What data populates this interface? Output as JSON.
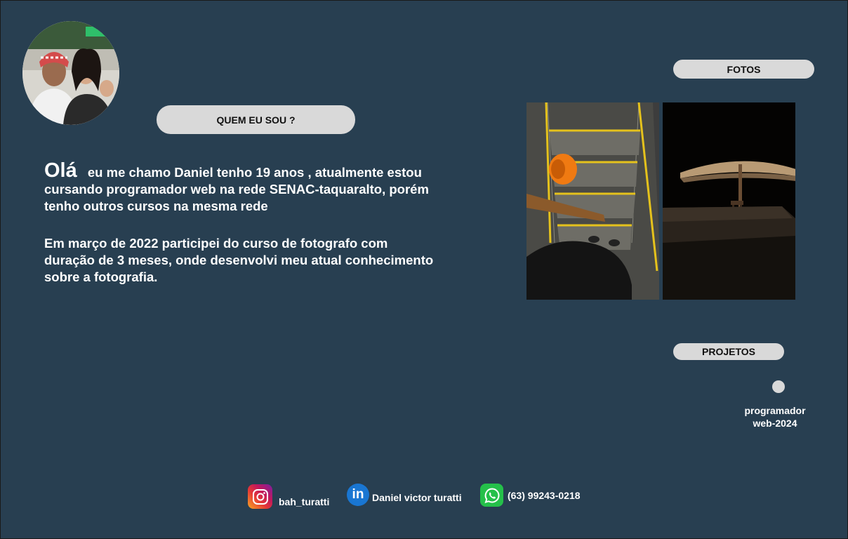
{
  "sections": {
    "about_label": "QUEM EU SOU ?",
    "photos_label": "FOTOS",
    "projects_label": "PROJETOS"
  },
  "intro": {
    "greeting": "Olá",
    "text": "eu me chamo Daniel tenho 19 anos , atualmente estou cursando programador web na rede SENAC-taquaralto, porém tenho outros cursos na mesma rede",
    "paragraph2": "Em março de 2022 participei do curso de fotografo com duração de 3 meses, onde desenvolvi meu atual conhecimento sobre a fotografia."
  },
  "projects": {
    "item_label": "programador web-2024"
  },
  "social": {
    "instagram": "bah_turatti",
    "linkedin": "Daniel victor turatti",
    "whatsapp": "(63) 99243-0218",
    "linkedin_icon_text": "in"
  },
  "colors": {
    "background": "#283f51",
    "pill": "#d9d9d9",
    "text": "#ffffff"
  },
  "icons": [
    "instagram-icon",
    "linkedin-icon",
    "whatsapp-icon"
  ]
}
